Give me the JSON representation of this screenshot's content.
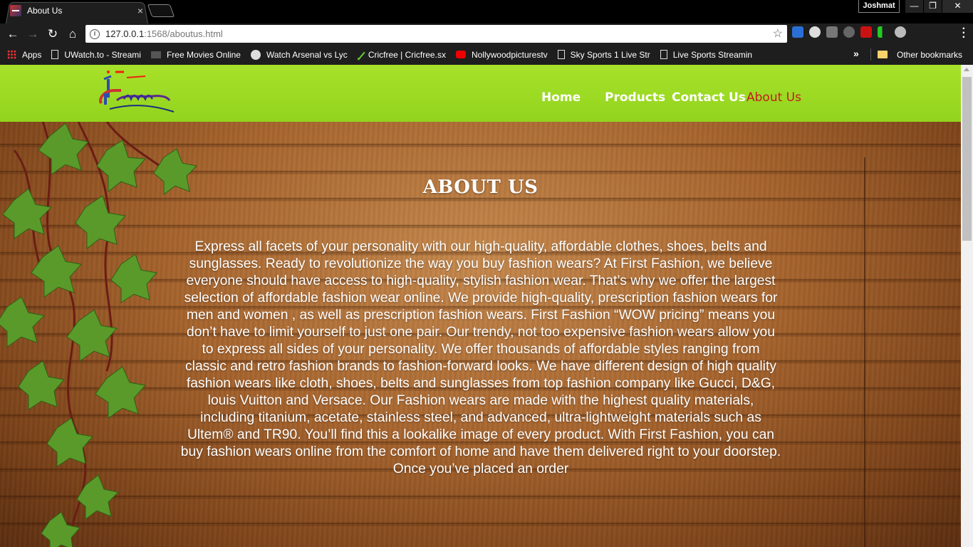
{
  "browser": {
    "tab_title": "About Us",
    "tab_close": "×",
    "profile_name": "Joshmat",
    "window_buttons": {
      "minimize": "—",
      "restore": "❐",
      "close": "✕"
    },
    "nav": {
      "back": "←",
      "forward": "→",
      "reload": "↻",
      "home": "⌂"
    },
    "url_host": "127.0.0.1",
    "url_rest": ":1568/aboutus.html",
    "star": "☆",
    "bookmarks": [
      {
        "label": "Apps",
        "icon": "apps-grid-icon"
      },
      {
        "label": "UWatch.to - Streami",
        "icon": "page-icon"
      },
      {
        "label": "Free Movies Online",
        "icon": "film-icon"
      },
      {
        "label": "Watch Arsenal vs Lyc",
        "icon": "soccer-icon"
      },
      {
        "label": "Cricfree | Cricfree.sx",
        "icon": "cricfree-icon"
      },
      {
        "label": "Nollywoodpicturestv",
        "icon": "youtube-icon"
      },
      {
        "label": "Sky Sports 1 Live Str",
        "icon": "page-icon"
      },
      {
        "label": "Live Sports Streamin",
        "icon": "page-icon"
      }
    ],
    "bookmarks_overflow": "»",
    "other_bookmarks": "Other bookmarks"
  },
  "site": {
    "logo_alt": "1st Fashion",
    "nav": [
      {
        "label": "Home",
        "active": false
      },
      {
        "label": "Products",
        "active": false
      },
      {
        "label": "Contact Us",
        "active": false
      },
      {
        "label": "About Us",
        "active": true
      }
    ],
    "colors": {
      "header": "#9ad923",
      "active_link": "#c41d1d",
      "text": "#ffffff"
    }
  },
  "about": {
    "title": "ABOUT US",
    "body": "Express all facets of your personality with our high-quality, affordable clothes, shoes, belts and sunglasses. Ready to revolutionize the way you buy fashion wears? At First Fashion, we believe everyone should have access to high-quality, stylish fashion wear. That’s why we offer the largest selection of affordable fashion wear online. We provide high-quality, prescription fashion wears for men and women , as well as prescription fashion wears. First Fashion “WOW pricing” means you don’t have to limit yourself to just one pair. Our trendy, not too expensive fashion wears allow you to express all sides of your personality. We offer thousands of affordable styles ranging from classic and retro fashion brands to fashion-forward looks. We have different design of high quality fashion wears like cloth, shoes, belts and sunglasses from top fashion company like Gucci, D&G, louis Vuitton and Versace. Our Fashion wears are made with the highest quality materials, including titanium, acetate, stainless steel, and advanced, ultra-lightweight materials such as Ultem® and TR90. You’ll find this a lookalike image of every product. With First Fashion, you can buy fashion wears online from the comfort of home and have them delivered right to your doorstep. Once you’ve placed an order"
  }
}
